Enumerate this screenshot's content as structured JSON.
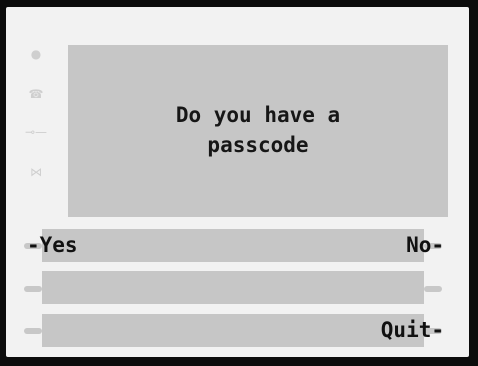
{
  "screen": {
    "prompt": "Do you have a\npasscode"
  },
  "softkeys": {
    "left_1": "-Yes",
    "right_1": "No-",
    "right_3": "Quit-"
  },
  "side_icons": [
    "light-icon",
    "phone-icon",
    "key-icon",
    "bowtie-icon"
  ]
}
